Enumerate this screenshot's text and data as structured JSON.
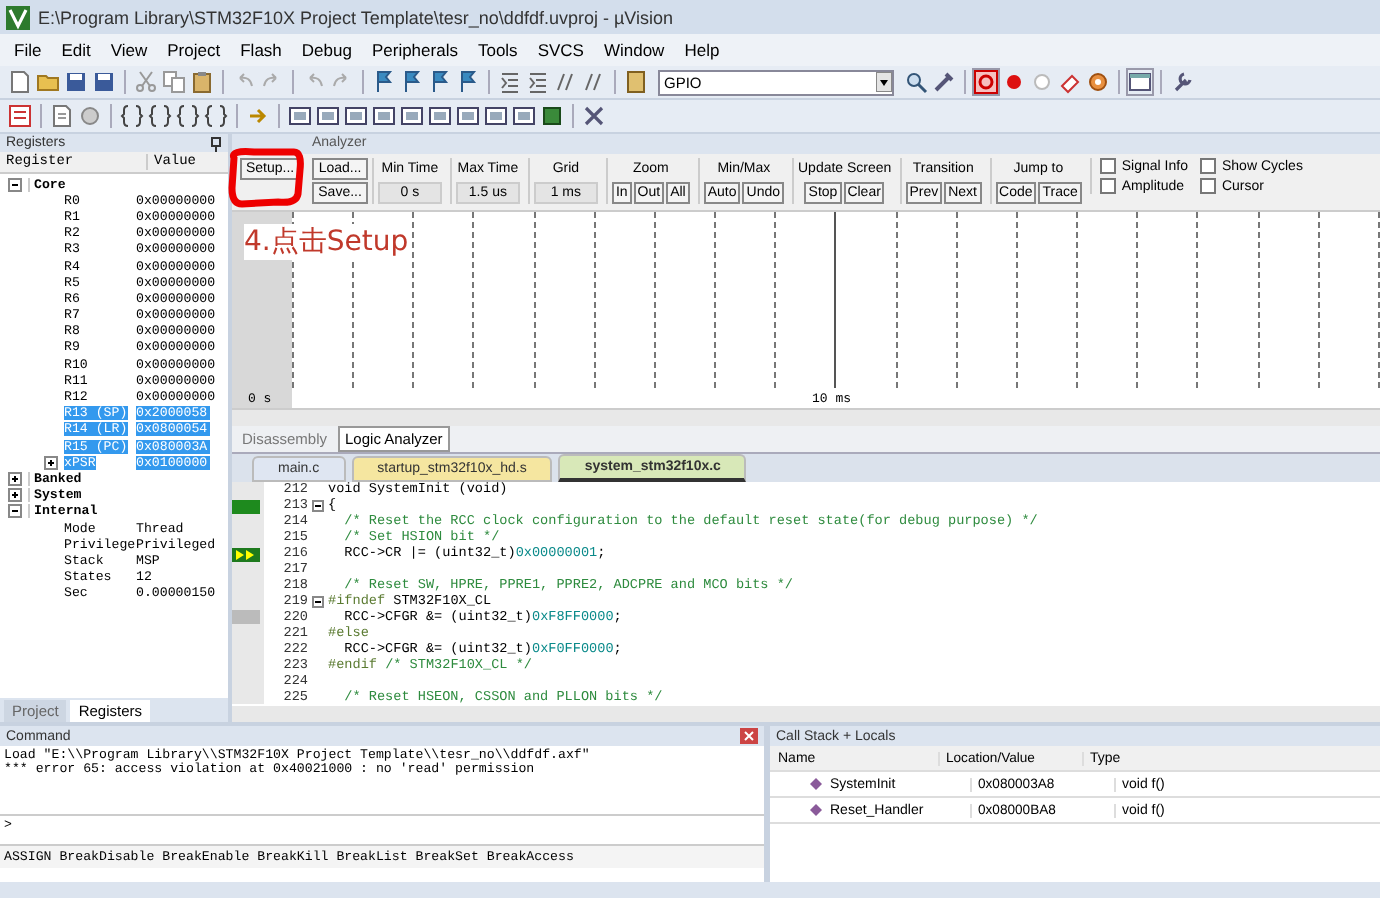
{
  "window": {
    "title": "E:\\Program Library\\STM32F10X Project Template\\tesr_no\\ddfdf.uvproj - µVision"
  },
  "menu": [
    "File",
    "Edit",
    "View",
    "Project",
    "Flash",
    "Debug",
    "Peripherals",
    "Tools",
    "SVCS",
    "Window",
    "Help"
  ],
  "toolbar": {
    "target_field": {
      "value": "GPIO"
    }
  },
  "registers_panel": {
    "title": "Registers",
    "columns": [
      "Register",
      "Value"
    ],
    "items": [
      {
        "name": "Core",
        "expanded": true,
        "selected": false,
        "children": [
          {
            "name": "R0",
            "value": "0x00000000",
            "selected": false
          },
          {
            "name": "R1",
            "value": "0x00000000",
            "selected": false
          },
          {
            "name": "R2",
            "value": "0x00000000",
            "selected": false
          },
          {
            "name": "R3",
            "value": "0x00000000",
            "selected": false
          },
          {
            "name": "R4",
            "value": "0x00000000",
            "selected": false
          },
          {
            "name": "R5",
            "value": "0x00000000",
            "selected": false
          },
          {
            "name": "R6",
            "value": "0x00000000",
            "selected": false
          },
          {
            "name": "R7",
            "value": "0x00000000",
            "selected": false
          },
          {
            "name": "R8",
            "value": "0x00000000",
            "selected": false
          },
          {
            "name": "R9",
            "value": "0x00000000",
            "selected": false
          },
          {
            "name": "R10",
            "value": "0x00000000",
            "selected": false
          },
          {
            "name": "R11",
            "value": "0x00000000",
            "selected": false
          },
          {
            "name": "R12",
            "value": "0x00000000",
            "selected": false
          },
          {
            "name": "R13 (SP)",
            "value": "0x2000058",
            "selected": true
          },
          {
            "name": "R14 (LR)",
            "value": "0x0800054",
            "selected": true
          },
          {
            "name": "R15 (PC)",
            "value": "0x080003A",
            "selected": true
          },
          {
            "name": "xPSR",
            "value": "0x0100000",
            "selected": true,
            "expanded": false
          }
        ]
      },
      {
        "name": "Banked",
        "expanded": false,
        "selected": false
      },
      {
        "name": "System",
        "expanded": false,
        "selected": false
      },
      {
        "name": "Internal",
        "expanded": true,
        "selected": false,
        "children": [
          {
            "name": "Mode",
            "value": "Thread",
            "selected": false
          },
          {
            "name": "Privilege",
            "value": "Privileged",
            "selected": false
          },
          {
            "name": "Stack",
            "value": "MSP",
            "selected": false
          },
          {
            "name": "States",
            "value": "12",
            "selected": false
          },
          {
            "name": "Sec",
            "value": "0.00000150",
            "selected": false
          }
        ]
      }
    ],
    "tabs": [
      {
        "label": "Project",
        "selected": false
      },
      {
        "label": "Registers",
        "selected": true
      }
    ]
  },
  "logic_analyzer": {
    "title": "Analyzer",
    "buttons_a": [
      "Setup...",
      "Load...",
      "Save..."
    ],
    "fields": [
      {
        "label": "Min Time",
        "value": "0 s"
      },
      {
        "label": "Max Time",
        "value": "1.5 us"
      },
      {
        "label": "Grid",
        "value": "1 ms"
      }
    ],
    "groups": [
      {
        "label": "Zoom",
        "buttons": [
          "In",
          "Out",
          "All"
        ]
      },
      {
        "label": "Min/Max",
        "buttons": [
          "Auto",
          "Undo"
        ]
      },
      {
        "label": "Update Screen",
        "buttons": [
          "Stop",
          "Clear"
        ]
      },
      {
        "label": "Transition",
        "buttons": [
          "Prev",
          "Next"
        ]
      },
      {
        "label": "Jump to",
        "buttons": [
          "Code",
          "Trace"
        ]
      }
    ],
    "checkboxes": [
      {
        "label": "Signal Info",
        "checked": false
      },
      {
        "label": "Show Cycles",
        "checked": false
      },
      {
        "label": "Amplitude",
        "checked": false
      },
      {
        "label": "Cursor",
        "checked": false
      }
    ],
    "axis_labels": [
      "0 s",
      "10 ms"
    ],
    "annotation": "4.点击Setup"
  },
  "view_tabs": [
    {
      "label": "Disassembly",
      "selected": false
    },
    {
      "label": "Logic Analyzer",
      "selected": true
    }
  ],
  "file_tabs": [
    {
      "label": "main.c",
      "selected": false,
      "color": "#dfe6f2"
    },
    {
      "label": "startup_stm32f10x_hd.s",
      "selected": false,
      "color": "#f5e6a0"
    },
    {
      "label": "system_stm32f10x.c",
      "selected": true,
      "color": "#d8e8b8"
    }
  ],
  "code": [
    {
      "line": "212",
      "executed": false,
      "current": false,
      "marked": false,
      "fold": false,
      "segments": [
        {
          "text": "void SystemInit (void)",
          "kind": "code"
        }
      ]
    },
    {
      "line": "213",
      "executed": true,
      "current": false,
      "marked": false,
      "fold": true,
      "segments": [
        {
          "text": "{",
          "kind": "code"
        }
      ]
    },
    {
      "line": "214",
      "executed": false,
      "current": false,
      "marked": false,
      "fold": false,
      "segments": [
        {
          "text": "  /* Reset the RCC clock configuration to the default reset state(for debug purpose) */",
          "kind": "comment"
        }
      ]
    },
    {
      "line": "215",
      "executed": false,
      "current": false,
      "marked": false,
      "fold": false,
      "segments": [
        {
          "text": "  /* Set HSION bit */",
          "kind": "comment"
        }
      ]
    },
    {
      "line": "216",
      "executed": false,
      "current": true,
      "marked": false,
      "fold": false,
      "segments": [
        {
          "text": "  RCC->CR |= (uint32_t)",
          "kind": "code"
        },
        {
          "text": "0x00000001",
          "kind": "number"
        },
        {
          "text": ";",
          "kind": "code"
        }
      ]
    },
    {
      "line": "217",
      "executed": false,
      "current": false,
      "marked": false,
      "fold": false
    },
    {
      "line": "218",
      "executed": false,
      "current": false,
      "marked": false,
      "fold": false,
      "segments": [
        {
          "text": "  /* Reset SW, HPRE, PPRE1, PPRE2, ADCPRE and MCO bits */",
          "kind": "comment"
        }
      ]
    },
    {
      "line": "219",
      "executed": false,
      "current": false,
      "marked": false,
      "fold": true,
      "segments": [
        {
          "text": "#ifndef",
          "kind": "directive"
        },
        {
          "text": " STM32F10X_CL",
          "kind": "code"
        }
      ]
    },
    {
      "line": "220",
      "executed": false,
      "current": false,
      "marked": true,
      "fold": false,
      "segments": [
        {
          "text": "  RCC->CFGR &= (uint32_t)",
          "kind": "code"
        },
        {
          "text": "0xF8FF0000",
          "kind": "number"
        },
        {
          "text": ";",
          "kind": "code"
        }
      ]
    },
    {
      "line": "221",
      "executed": false,
      "current": false,
      "marked": false,
      "fold": false,
      "segments": [
        {
          "text": "#else",
          "kind": "directive"
        }
      ]
    },
    {
      "line": "222",
      "executed": false,
      "current": false,
      "marked": false,
      "fold": false,
      "segments": [
        {
          "text": "  RCC->CFGR &= (uint32_t)",
          "kind": "code"
        },
        {
          "text": "0xF0FF0000",
          "kind": "number"
        },
        {
          "text": ";",
          "kind": "code"
        }
      ]
    },
    {
      "line": "223",
      "executed": false,
      "current": false,
      "marked": false,
      "fold": false,
      "segments": [
        {
          "text": "#endif",
          "kind": "directive"
        },
        {
          "text": " /* STM32F10X_CL */",
          "kind": "comment"
        }
      ]
    },
    {
      "line": "224",
      "executed": false,
      "current": false,
      "marked": false,
      "fold": false
    },
    {
      "line": "225",
      "executed": false,
      "current": false,
      "marked": false,
      "fold": false,
      "segments": [
        {
          "text": "  /* Reset HSEON, CSSON and PLLON bits */",
          "kind": "comment"
        }
      ]
    }
  ],
  "command_panel": {
    "title": "Command",
    "lines": [
      "Load \"E:\\\\Program Library\\\\STM32F10X Project Template\\\\tesr_no\\\\ddfdf.axf\"",
      "*** error 65: access violation at 0x40021000 : no 'read' permission"
    ],
    "prompt": ">",
    "help": "ASSIGN BreakDisable BreakEnable BreakKill BreakList BreakSet BreakAccess"
  },
  "call_stack": {
    "title": "Call Stack + Locals",
    "columns": [
      "Name",
      "Location/Value",
      "Type"
    ],
    "rows": [
      {
        "name": "SystemInit",
        "location": "0x080003A8",
        "type": "void f()"
      },
      {
        "name": "Reset_Handler",
        "location": "0x08000BA8",
        "type": "void f()"
      }
    ]
  }
}
